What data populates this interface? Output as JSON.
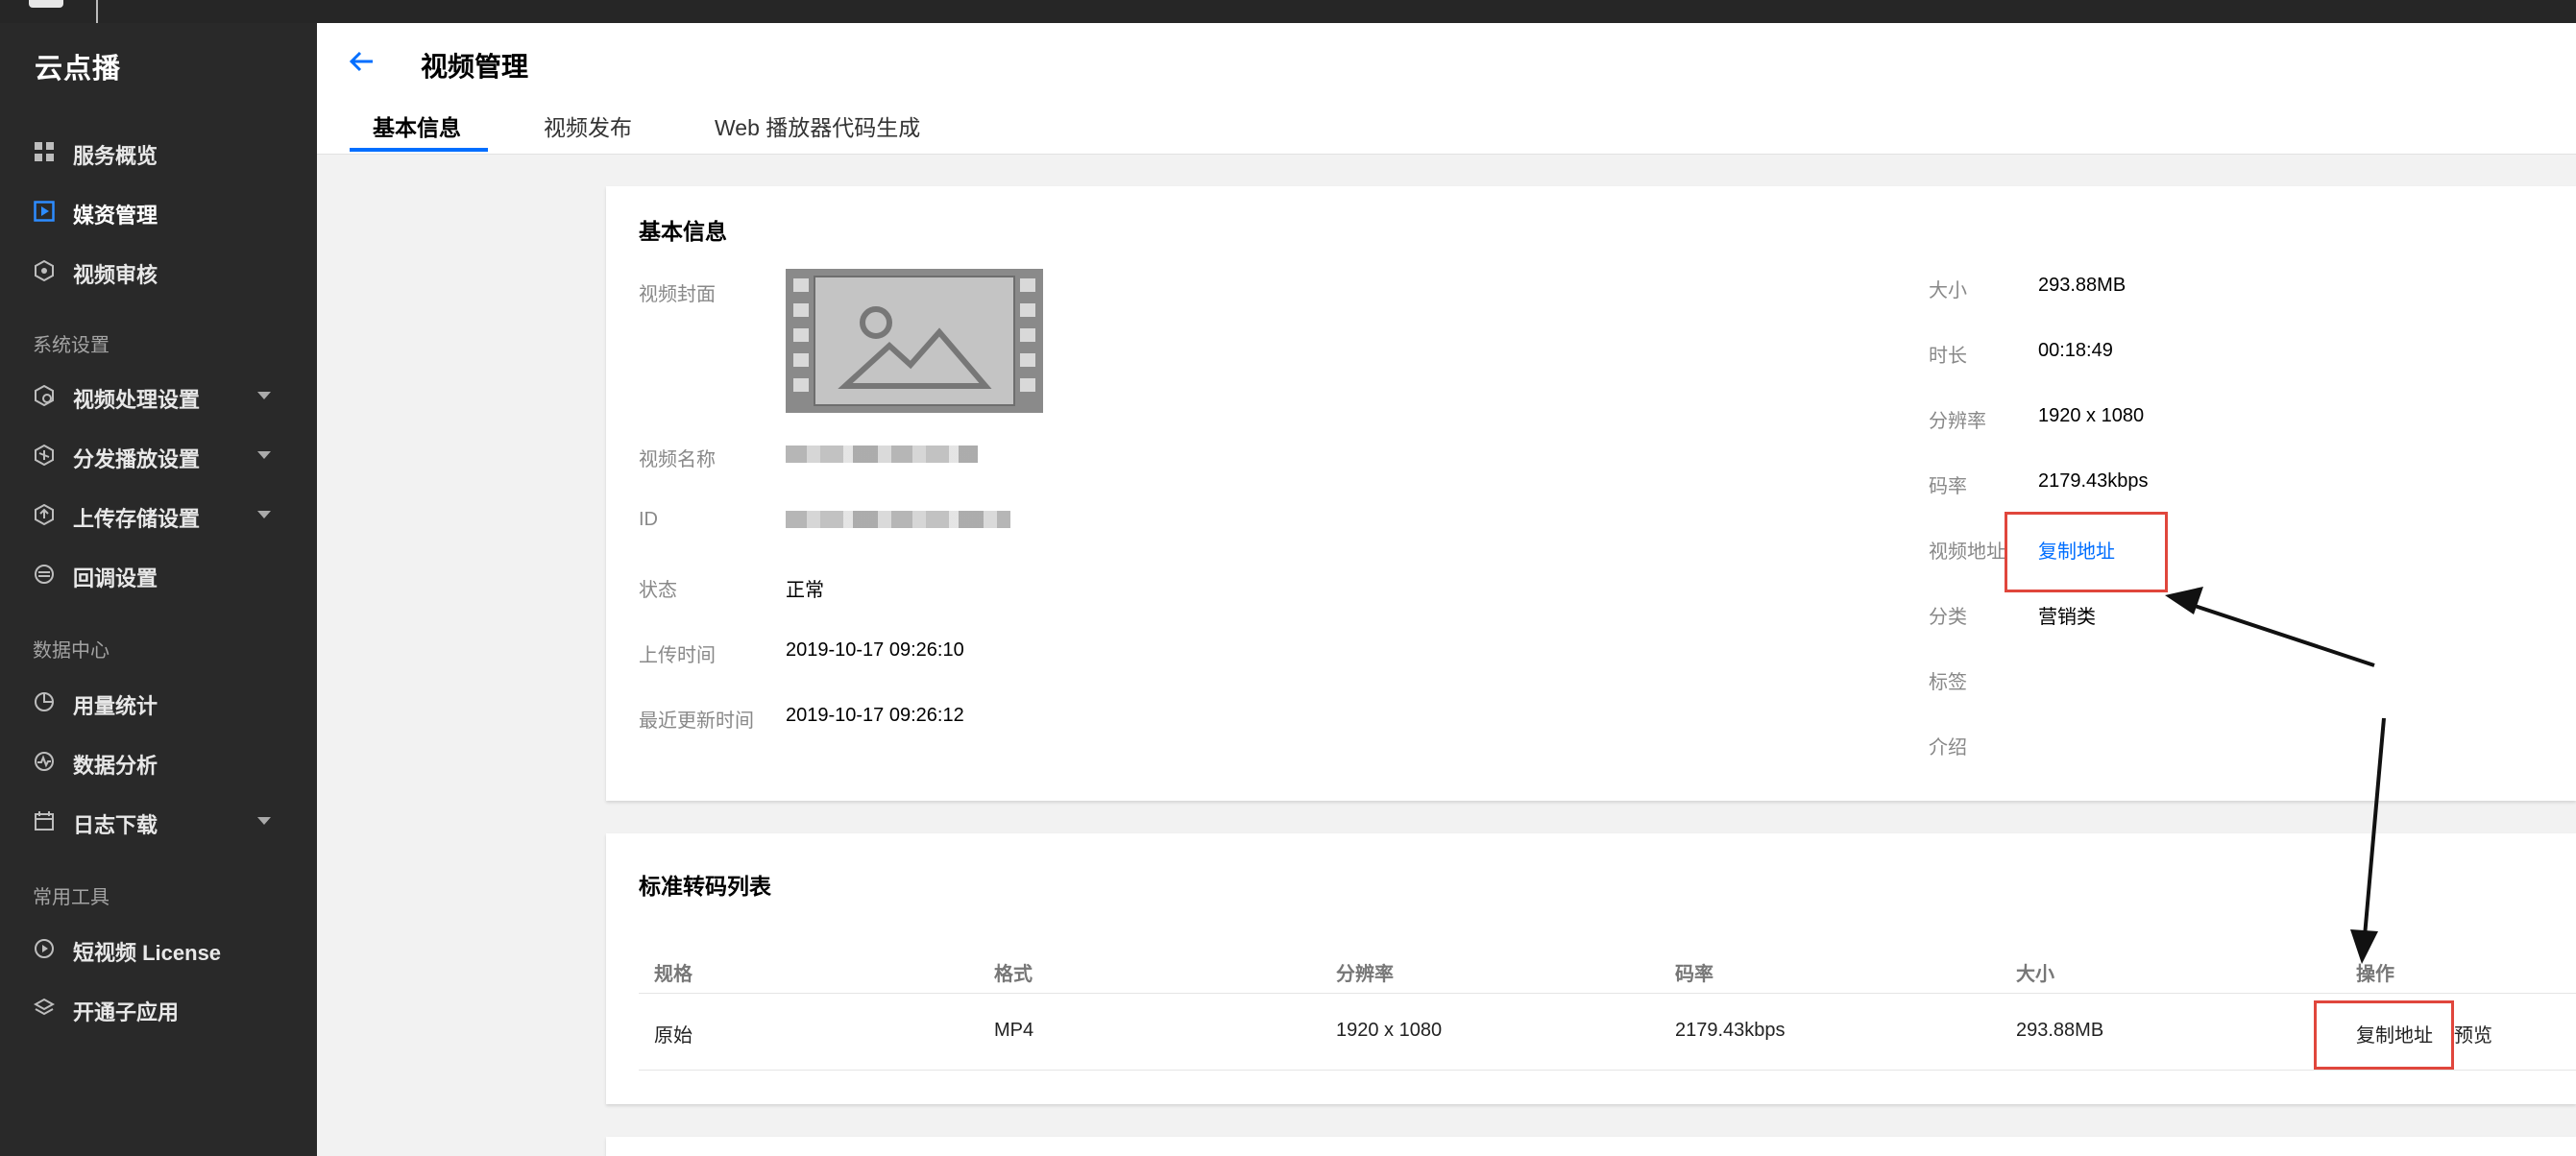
{
  "app": {
    "brand": "云点播"
  },
  "sidebar": {
    "items": [
      {
        "label": "服务概览",
        "icon": "grid-icon"
      },
      {
        "label": "媒资管理",
        "icon": "media-play-icon",
        "active": true
      },
      {
        "label": "视频审核",
        "icon": "review-icon"
      }
    ],
    "groups": [
      {
        "title": "系统设置",
        "items": [
          {
            "label": "视频处理设置",
            "icon": "video-process-icon",
            "expandable": true
          },
          {
            "label": "分发播放设置",
            "icon": "distribute-icon",
            "expandable": true
          },
          {
            "label": "上传存储设置",
            "icon": "upload-storage-icon",
            "expandable": true
          },
          {
            "label": "回调设置",
            "icon": "callback-icon"
          }
        ]
      },
      {
        "title": "数据中心",
        "items": [
          {
            "label": "用量统计",
            "icon": "pie-chart-icon"
          },
          {
            "label": "数据分析",
            "icon": "analysis-icon"
          },
          {
            "label": "日志下载",
            "icon": "calendar-icon",
            "expandable": true
          }
        ]
      },
      {
        "title": "常用工具",
        "items": [
          {
            "label": "短视频 License",
            "icon": "short-video-icon"
          },
          {
            "label": "开通子应用",
            "icon": "layers-icon"
          }
        ]
      }
    ]
  },
  "header": {
    "title": "视频管理",
    "tabs": [
      {
        "label": "基本信息",
        "active": true
      },
      {
        "label": "视频发布"
      },
      {
        "label": "Web 播放器代码生成"
      }
    ]
  },
  "basic_info": {
    "title": "基本信息",
    "left": {
      "cover_label": "视频封面",
      "name_label": "视频名称",
      "id_label": "ID",
      "status_label": "状态",
      "status_value": "正常",
      "upload_label": "上传时间",
      "upload_value": "2019-10-17 09:26:10",
      "updated_label": "最近更新时间",
      "updated_value": "2019-10-17 09:26:12"
    },
    "right": {
      "size_label": "大小",
      "size_value": "293.88MB",
      "duration_label": "时长",
      "duration_value": "00:18:49",
      "resolution_label": "分辨率",
      "resolution_value": "1920 x 1080",
      "bitrate_label": "码率",
      "bitrate_value": "2179.43kbps",
      "url_label": "视频地址",
      "url_link": "复制地址",
      "category_label": "分类",
      "category_value": "营销类",
      "tags_label": "标签",
      "intro_label": "介绍"
    }
  },
  "transcode": {
    "title": "标准转码列表",
    "columns": [
      "规格",
      "格式",
      "分辨率",
      "码率",
      "大小",
      "操作"
    ],
    "rows": [
      {
        "spec": "原始",
        "format": "MP4",
        "resolution": "1920 x 1080",
        "bitrate": "2179.43kbps",
        "size": "293.88MB",
        "action_copy": "复制地址",
        "action_preview": "预览"
      }
    ]
  },
  "colors": {
    "sidebar_bg": "#292929",
    "accent": "#006eff",
    "highlight_box": "#e0463c",
    "page_bg": "#f2f2f2"
  }
}
